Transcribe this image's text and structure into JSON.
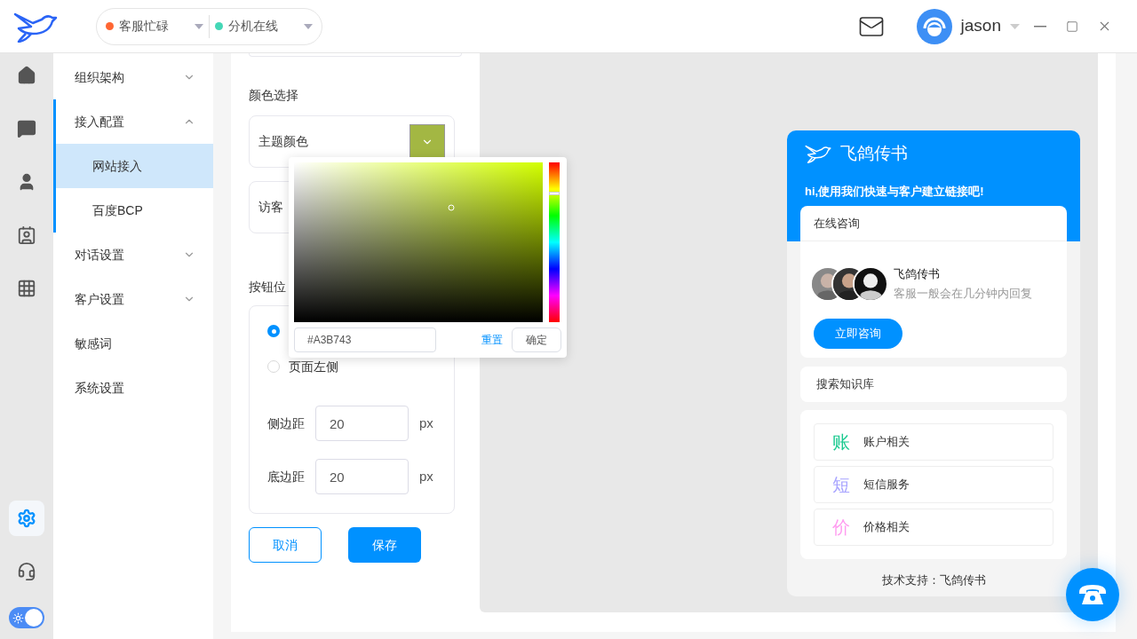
{
  "header": {
    "statuses": [
      {
        "label": "客服忙碌",
        "color": "#ff6633"
      },
      {
        "label": "分机在线",
        "color": "#44d7b6"
      }
    ],
    "user": {
      "name": "jason"
    }
  },
  "rail": {
    "items": [
      {
        "kind": "home",
        "selected": false
      },
      {
        "kind": "chat",
        "selected": false
      },
      {
        "kind": "user",
        "selected": false
      },
      {
        "kind": "contacts",
        "selected": false
      },
      {
        "kind": "grid",
        "selected": false
      }
    ],
    "bottom": [
      {
        "kind": "settings",
        "selected": true
      },
      {
        "kind": "support",
        "selected": false
      }
    ],
    "theme_switch": {
      "on": true
    }
  },
  "subnav": [
    {
      "label": "组织架构",
      "expandable": true,
      "expanded": false
    },
    {
      "label": "接入配置",
      "expandable": true,
      "expanded": true,
      "children": [
        {
          "label": "网站接入",
          "selected": true
        },
        {
          "label": "百度BCP",
          "selected": false
        }
      ]
    },
    {
      "label": "对话设置",
      "expandable": true,
      "expanded": false
    },
    {
      "label": "客户设置",
      "expandable": true,
      "expanded": false
    },
    {
      "label": "敏感词",
      "expandable": false,
      "expanded": false
    },
    {
      "label": "系统设置",
      "expandable": false,
      "expanded": false
    }
  ],
  "form": {
    "color_section": "颜色选择",
    "theme_color": {
      "label": "主题颜色",
      "color": "#a3b743"
    },
    "visitor_label": "访客",
    "position_section": "按钮位",
    "positions": [
      {
        "selected": true
      },
      {
        "label": "页面左侧",
        "selected": false
      }
    ],
    "side_margin": {
      "label": "侧边距",
      "value": "20",
      "unit": "px"
    },
    "bottom_margin": {
      "label": "底边距",
      "value": "20",
      "unit": "px"
    },
    "cancel": "取消",
    "save": "保存"
  },
  "color_picker": {
    "hex": "#A3B743",
    "reset": "重置",
    "confirm": "确定"
  },
  "preview": {
    "brand": "飞鸽传书",
    "greeting": "hi,使用我们快速与客户建立链接吧!",
    "online": {
      "title": "在线咨询",
      "agent_name": "飞鸽传书",
      "agent_note": "客服一般会在几分钟内回复",
      "button": "立即咨询"
    },
    "search_kb": "搜索知识库",
    "topics": [
      {
        "glyph": "账",
        "label": "账户相关",
        "color": "#19c98f"
      },
      {
        "glyph": "短",
        "label": "短信服务",
        "color": "#a8a4ff"
      },
      {
        "glyph": "价",
        "label": "价格相关",
        "color": "#ff9cf0"
      }
    ],
    "footer": "技术支持：飞鸽传书"
  }
}
